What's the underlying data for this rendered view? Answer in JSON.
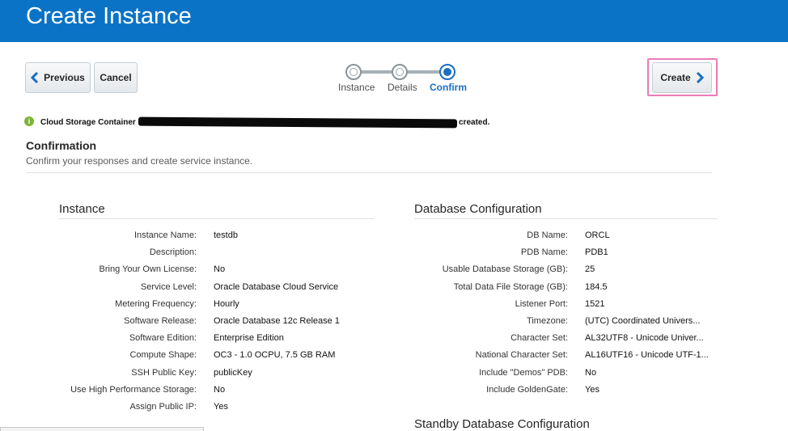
{
  "header": {
    "title": "Create Instance"
  },
  "toolbar": {
    "previous_label": "Previous",
    "cancel_label": "Cancel",
    "create_label": "Create"
  },
  "train": {
    "steps": [
      {
        "label": "Instance",
        "state": "visited"
      },
      {
        "label": "Details",
        "state": "visited"
      },
      {
        "label": "Confirm",
        "state": "current"
      }
    ]
  },
  "message": {
    "prefix": "Cloud Storage Container",
    "suffix": "created.",
    "icon": "info-icon"
  },
  "confirmation": {
    "title": "Confirmation",
    "subtitle": "Confirm your responses and create service instance."
  },
  "instance": {
    "title": "Instance",
    "rows": [
      {
        "label": "Instance Name:",
        "value": "testdb"
      },
      {
        "label": "Description:",
        "value": ""
      },
      {
        "label": "Bring Your Own License:",
        "value": "No"
      },
      {
        "label": "Service Level:",
        "value": "Oracle Database Cloud Service"
      },
      {
        "label": "Metering Frequency:",
        "value": "Hourly"
      },
      {
        "label": "Software Release:",
        "value": "Oracle Database 12c Release 1"
      },
      {
        "label": "Software Edition:",
        "value": "Enterprise Edition"
      },
      {
        "label": "Compute Shape:",
        "value": "OC3 - 1.0 OCPU, 7.5 GB RAM"
      },
      {
        "label": "SSH Public Key:",
        "value": "publicKey"
      },
      {
        "label": "Use High Performance Storage:",
        "value": "No"
      },
      {
        "label": "Assign Public IP:",
        "value": "Yes"
      }
    ]
  },
  "database": {
    "title": "Database Configuration",
    "rows": [
      {
        "label": "DB Name:",
        "value": "ORCL"
      },
      {
        "label": "PDB Name:",
        "value": "PDB1"
      },
      {
        "label": "Usable Database Storage (GB):",
        "value": "25"
      },
      {
        "label": "Total Data File Storage (GB):",
        "value": "184.5"
      },
      {
        "label": "Listener Port:",
        "value": "1521"
      },
      {
        "label": "Timezone:",
        "value": "(UTC) Coordinated Univers..."
      },
      {
        "label": "Character Set:",
        "value": "AL32UTF8 - Unicode Univer..."
      },
      {
        "label": "National Character Set:",
        "value": "AL16UTF16 - Unicode UTF-1..."
      },
      {
        "label": "Include \"Demos\" PDB:",
        "value": "No"
      },
      {
        "label": "Include GoldenGate:",
        "value": "Yes"
      }
    ]
  },
  "standby": {
    "title": "Standby Database Configuration"
  },
  "colors": {
    "header": "#0b73c5",
    "accent": "#1b6ec2",
    "highlight": "#ec7ab8",
    "info": "#7bb536"
  }
}
